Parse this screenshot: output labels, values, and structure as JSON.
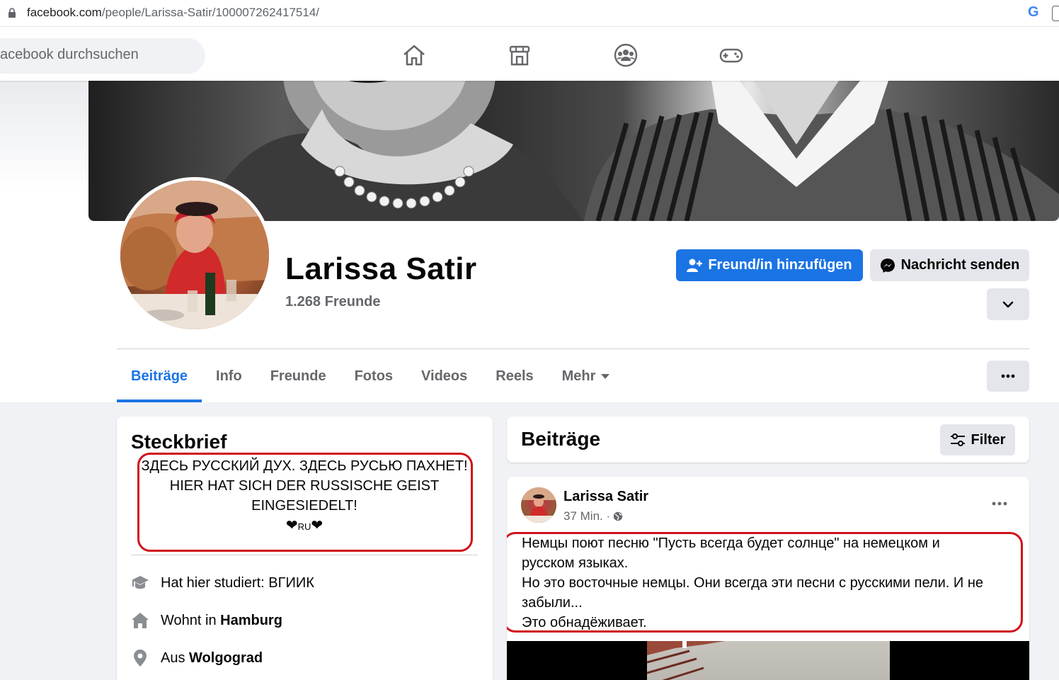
{
  "browser": {
    "url_domain": "facebook.com",
    "url_path": "/people/Larissa-Satir/100007262417514/",
    "google_icon": "G"
  },
  "fbnav": {
    "search_placeholder": "acebook durchsuchen",
    "icons": [
      "home-icon",
      "marketplace-icon",
      "groups-icon",
      "gaming-icon"
    ]
  },
  "profile": {
    "name": "Larissa Satir",
    "friends": "1.268 Freunde",
    "add_friend": "Freund/in hinzufügen",
    "message": "Nachricht senden"
  },
  "tabs": [
    {
      "label": "Beiträge",
      "active": true
    },
    {
      "label": "Info"
    },
    {
      "label": "Freunde"
    },
    {
      "label": "Fotos"
    },
    {
      "label": "Videos"
    },
    {
      "label": "Reels"
    },
    {
      "label": "Mehr"
    }
  ],
  "intro": {
    "title": "Steckbrief",
    "bio_line1": "ЗДЕСЬ РУССКИЙ ДУХ. ЗДЕСЬ РУСЬЮ ПАХНЕТ!",
    "bio_line2": "HIER HAT SICH DER RUSSISCHE GEIST",
    "bio_line3": "EINGESIEDELT!",
    "bio_heart_left": "❤",
    "bio_ru": "RU",
    "bio_heart_right": "❤",
    "studied_prefix": "Hat hier studiert: ",
    "studied_value": "ВГИИК",
    "lives_prefix": "Wohnt in ",
    "lives_value": "Hamburg",
    "from_prefix": "Aus ",
    "from_value": "Wolgograd"
  },
  "posts_header": {
    "title": "Beiträge",
    "filter": "Filter"
  },
  "post": {
    "author": "Larissa Satir",
    "time": "37 Min. ·",
    "text_line1": "Немцы поют песню \"Пусть всегда будет солнце\" на немецком и",
    "text_line2": "русском языках.",
    "text_line3": "Но это восточные немцы. Они всегда эти песни с русскими пели. И не",
    "text_line4": "забыли...",
    "text_line5": "Это обнадёживает."
  },
  "colors": {
    "accent": "#1b74e4",
    "highlight_box": "#d0121b",
    "background": "#f0f2f5"
  }
}
